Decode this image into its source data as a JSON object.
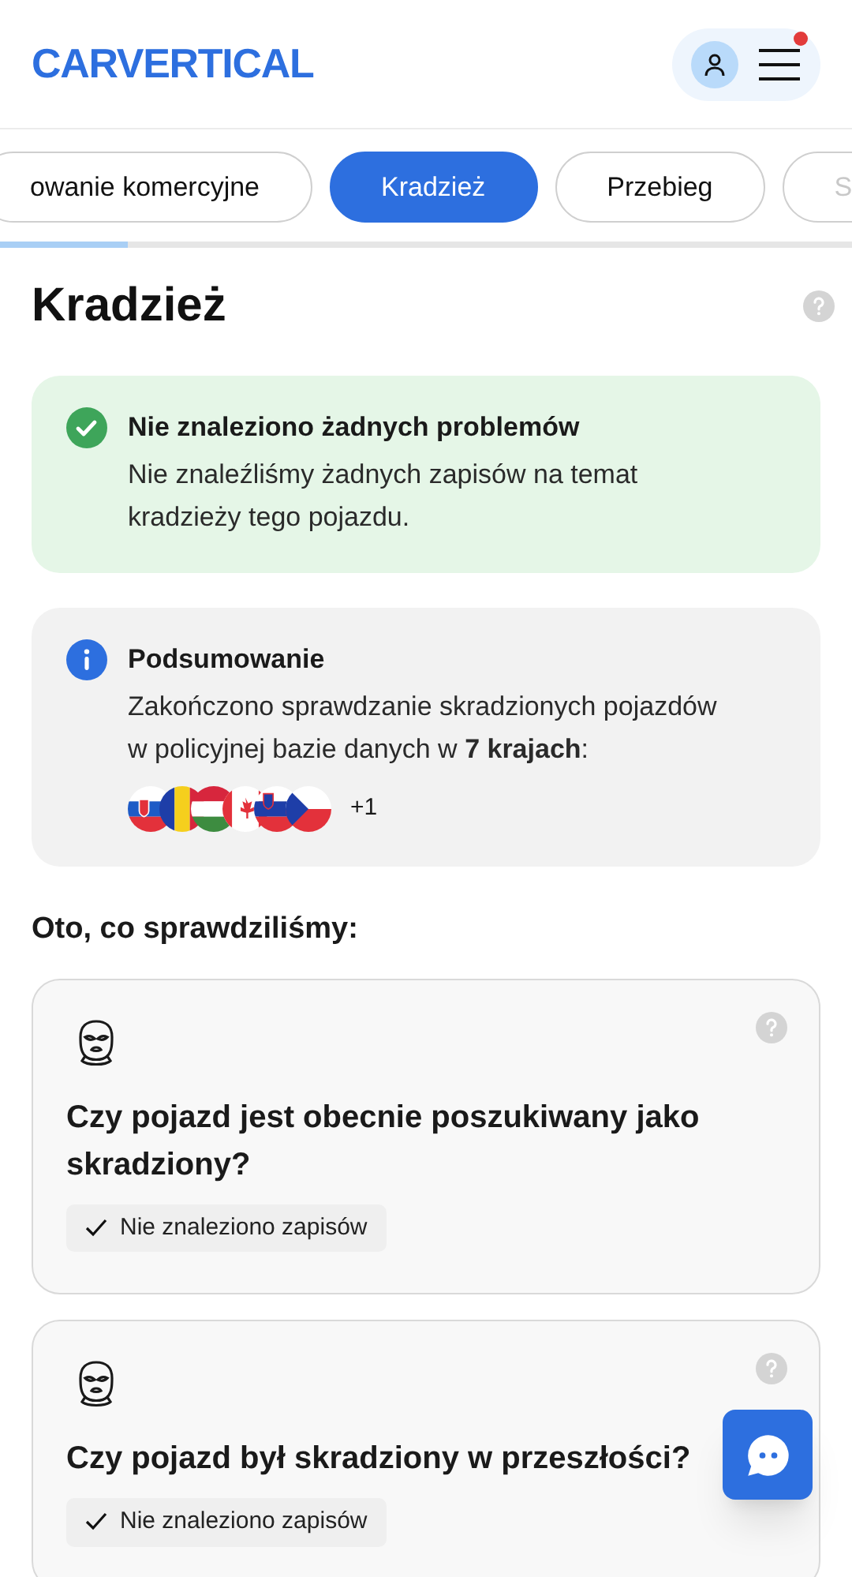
{
  "header": {
    "logo": "CARVERTICAL",
    "notification": true
  },
  "tabs": [
    {
      "label": "owanie komercyjne",
      "selected": false
    },
    {
      "label": "Kradzież",
      "selected": true
    },
    {
      "label": "Przebieg",
      "selected": false
    },
    {
      "label": "S",
      "selected": false
    }
  ],
  "title": "Kradzież",
  "alerts": [
    {
      "kind": "success",
      "heading": "Nie znaleziono żadnych problemów",
      "text": "Nie znaleźliśmy żadnych zapisów na temat kradzieży tego pojazdu."
    },
    {
      "kind": "info",
      "heading": "Podsumowanie",
      "text": "Zakończono sprawdzanie skradzionych pojazdów w policyjnej bazie danych w **7 krajach**:",
      "more": "+1"
    }
  ],
  "checks_heading": "Oto, co sprawdziliśmy:",
  "checks": [
    {
      "question": "Czy pojazd jest obecnie poszukiwany jako skradziony?",
      "result": "Nie znaleziono zapisów"
    },
    {
      "question": "Czy pojazd był skradziony w przeszłości?",
      "result": "Nie znaleziono zapisów"
    }
  ]
}
